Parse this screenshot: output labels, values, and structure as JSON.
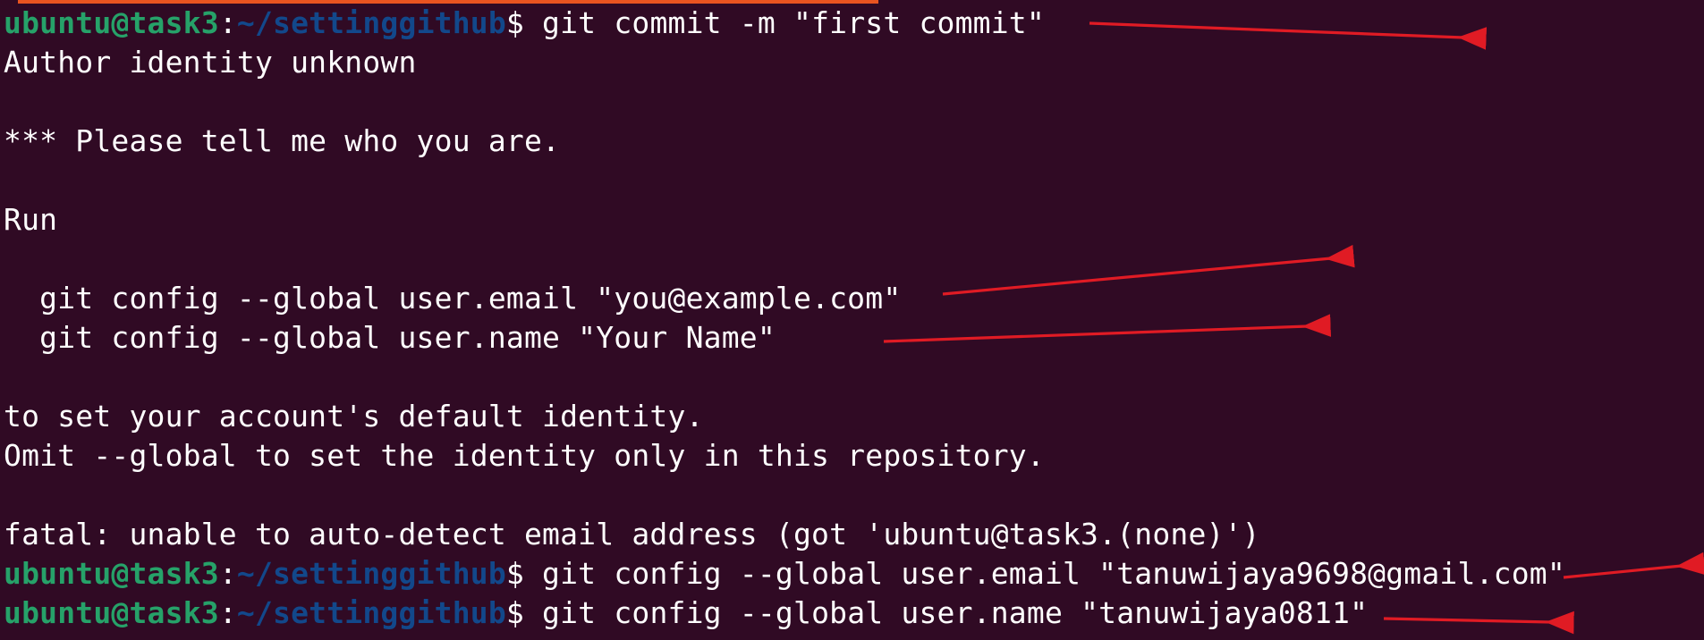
{
  "terminal": {
    "prompt": {
      "user_host": "ubuntu@task3",
      "separator": ":",
      "path": "~/settinggithub",
      "symbol": "$"
    },
    "lines": [
      {
        "type": "prompt",
        "command": " git commit -m \"first commit\""
      },
      {
        "type": "output",
        "text": "Author identity unknown"
      },
      {
        "type": "output",
        "text": ""
      },
      {
        "type": "output",
        "text": "*** Please tell me who you are."
      },
      {
        "type": "output",
        "text": ""
      },
      {
        "type": "output",
        "text": "Run"
      },
      {
        "type": "output",
        "text": ""
      },
      {
        "type": "output",
        "text": "  git config --global user.email \"you@example.com\""
      },
      {
        "type": "output",
        "text": "  git config --global user.name \"Your Name\""
      },
      {
        "type": "output",
        "text": ""
      },
      {
        "type": "output",
        "text": "to set your account's default identity."
      },
      {
        "type": "output",
        "text": "Omit --global to set the identity only in this repository."
      },
      {
        "type": "output",
        "text": ""
      },
      {
        "type": "output",
        "text": "fatal: unable to auto-detect email address (got 'ubuntu@task3.(none)')"
      },
      {
        "type": "prompt",
        "command": " git config --global user.email \"tanuwijaya9698@gmail.com\""
      },
      {
        "type": "prompt",
        "command": " git config --global user.name \"tanuwijaya0811\""
      }
    ]
  },
  "colors": {
    "background": "#300a24",
    "prompt_user": "#26a269",
    "prompt_path": "#12488b",
    "text": "#ffffff",
    "annotation_arrow": "#e01b24",
    "tab_accent": "#e95420"
  },
  "annotations": {
    "arrow_count": 5,
    "arrow_color": "#e01b24"
  }
}
